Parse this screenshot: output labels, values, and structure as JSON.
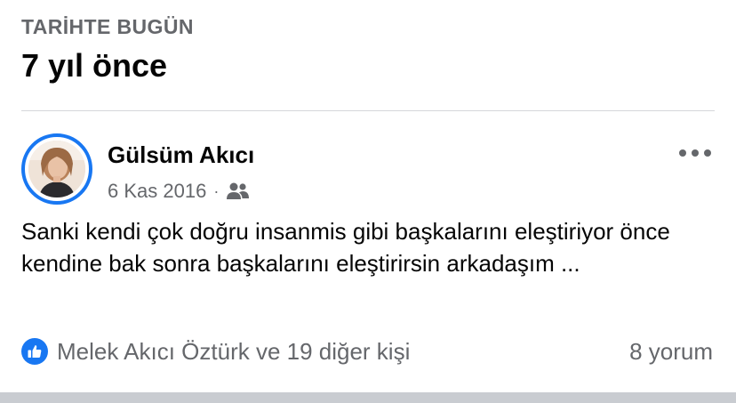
{
  "memory": {
    "kicker": "TARİHTE BUGÜN",
    "title": "7 yıl önce"
  },
  "post": {
    "author": "Gülsüm Akıcı",
    "date": "6 Kas 2016",
    "separator": "·",
    "audience_icon": "friends-icon",
    "text": "Sanki kendi çok doğru insanmis gibi başkalarını eleştiriyor önce kendine bak sonra başkalarını eleştirirsin arkadaşım ...",
    "reactions_text": "Melek Akıcı Öztürk ve 19 diğer kişi",
    "reaction_icon": "like-icon",
    "comments_text": "8 yorum"
  },
  "colors": {
    "accent": "#1877f2",
    "secondary_text": "#65676b",
    "divider": "#d5d7da",
    "band": "#c9ccd1"
  }
}
